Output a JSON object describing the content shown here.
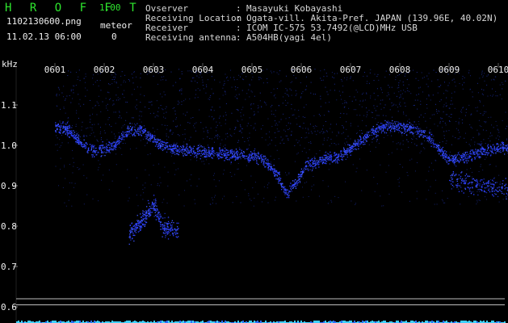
{
  "header": {
    "app_name": "H R O F F T",
    "version": "1.00",
    "filename": "1102130600.png",
    "datetime": "11.02.13 06:00",
    "counter_label": "meteor",
    "counter_value": "0",
    "info": [
      {
        "label": "Ovserver",
        "sep": ":",
        "value": "Masayuki Kobayashi"
      },
      {
        "label": "Receiving Location",
        "sep": ":",
        "value": "Ogata-vill. Akita-Pref. JAPAN (139.96E, 40.02N)"
      },
      {
        "label": "Receiver",
        "sep": ":",
        "value": "ICOM IC-575 53.7492(@LCD)MHz USB"
      },
      {
        "label": "Receiving antenna",
        "sep": ":",
        "value": "A504HB(yagi 4el)"
      }
    ]
  },
  "chart_data": {
    "type": "heatmap",
    "ylabel": "kHz",
    "x_ticks": [
      "0601",
      "0602",
      "0603",
      "0604",
      "0605",
      "0606",
      "0607",
      "0608",
      "0609",
      "0610"
    ],
    "y_ticks": [
      "1.1",
      "1.0",
      "0.9",
      "0.8",
      "0.7",
      "0.6"
    ],
    "y_tick_values": [
      1.1,
      1.0,
      0.9,
      0.8,
      0.7,
      0.6
    ],
    "ylim": [
      0.58,
      1.19
    ],
    "xlim_minutes": [
      0,
      10
    ],
    "reference_lines_khz": [
      0.605,
      0.62
    ],
    "colors": {
      "signal": "#2a3cff",
      "faint": "#14206e",
      "text": "#f0f0f0",
      "logo": "#2ee62e",
      "baseline": "#3fd0ff"
    },
    "traces": [
      {
        "name": "main",
        "points": [
          [
            0.0,
            1.045
          ],
          [
            0.25,
            1.04
          ],
          [
            0.5,
            1.01
          ],
          [
            0.8,
            0.985
          ],
          [
            1.2,
            1.0
          ],
          [
            1.5,
            1.04
          ],
          [
            1.8,
            1.035
          ],
          [
            2.1,
            1.005
          ],
          [
            2.5,
            0.99
          ],
          [
            3.0,
            0.985
          ],
          [
            3.5,
            0.98
          ],
          [
            4.0,
            0.975
          ],
          [
            4.3,
            0.96
          ],
          [
            4.5,
            0.93
          ],
          [
            4.7,
            0.88
          ],
          [
            4.9,
            0.91
          ],
          [
            5.1,
            0.95
          ],
          [
            5.4,
            0.965
          ],
          [
            5.8,
            0.975
          ],
          [
            6.1,
            1.005
          ],
          [
            6.4,
            1.03
          ],
          [
            6.7,
            1.05
          ],
          [
            7.0,
            1.045
          ],
          [
            7.3,
            1.04
          ],
          [
            7.6,
            1.02
          ],
          [
            7.8,
            0.99
          ],
          [
            8.0,
            0.965
          ],
          [
            8.3,
            0.97
          ],
          [
            8.6,
            0.985
          ],
          [
            8.9,
            0.995
          ],
          [
            9.2,
            0.995
          ],
          [
            9.5,
            1.005
          ],
          [
            9.8,
            1.02
          ],
          [
            10.0,
            1.03
          ]
        ]
      },
      {
        "name": "secondary",
        "points": [
          [
            1.5,
            0.78
          ],
          [
            1.8,
            0.82
          ],
          [
            2.0,
            0.85
          ],
          [
            2.2,
            0.8
          ],
          [
            2.5,
            0.79
          ]
        ]
      },
      {
        "name": "lower-right",
        "points": [
          [
            8.0,
            0.915
          ],
          [
            8.5,
            0.905
          ],
          [
            9.0,
            0.895
          ],
          [
            9.5,
            0.89
          ],
          [
            10.0,
            0.9
          ]
        ]
      }
    ]
  }
}
